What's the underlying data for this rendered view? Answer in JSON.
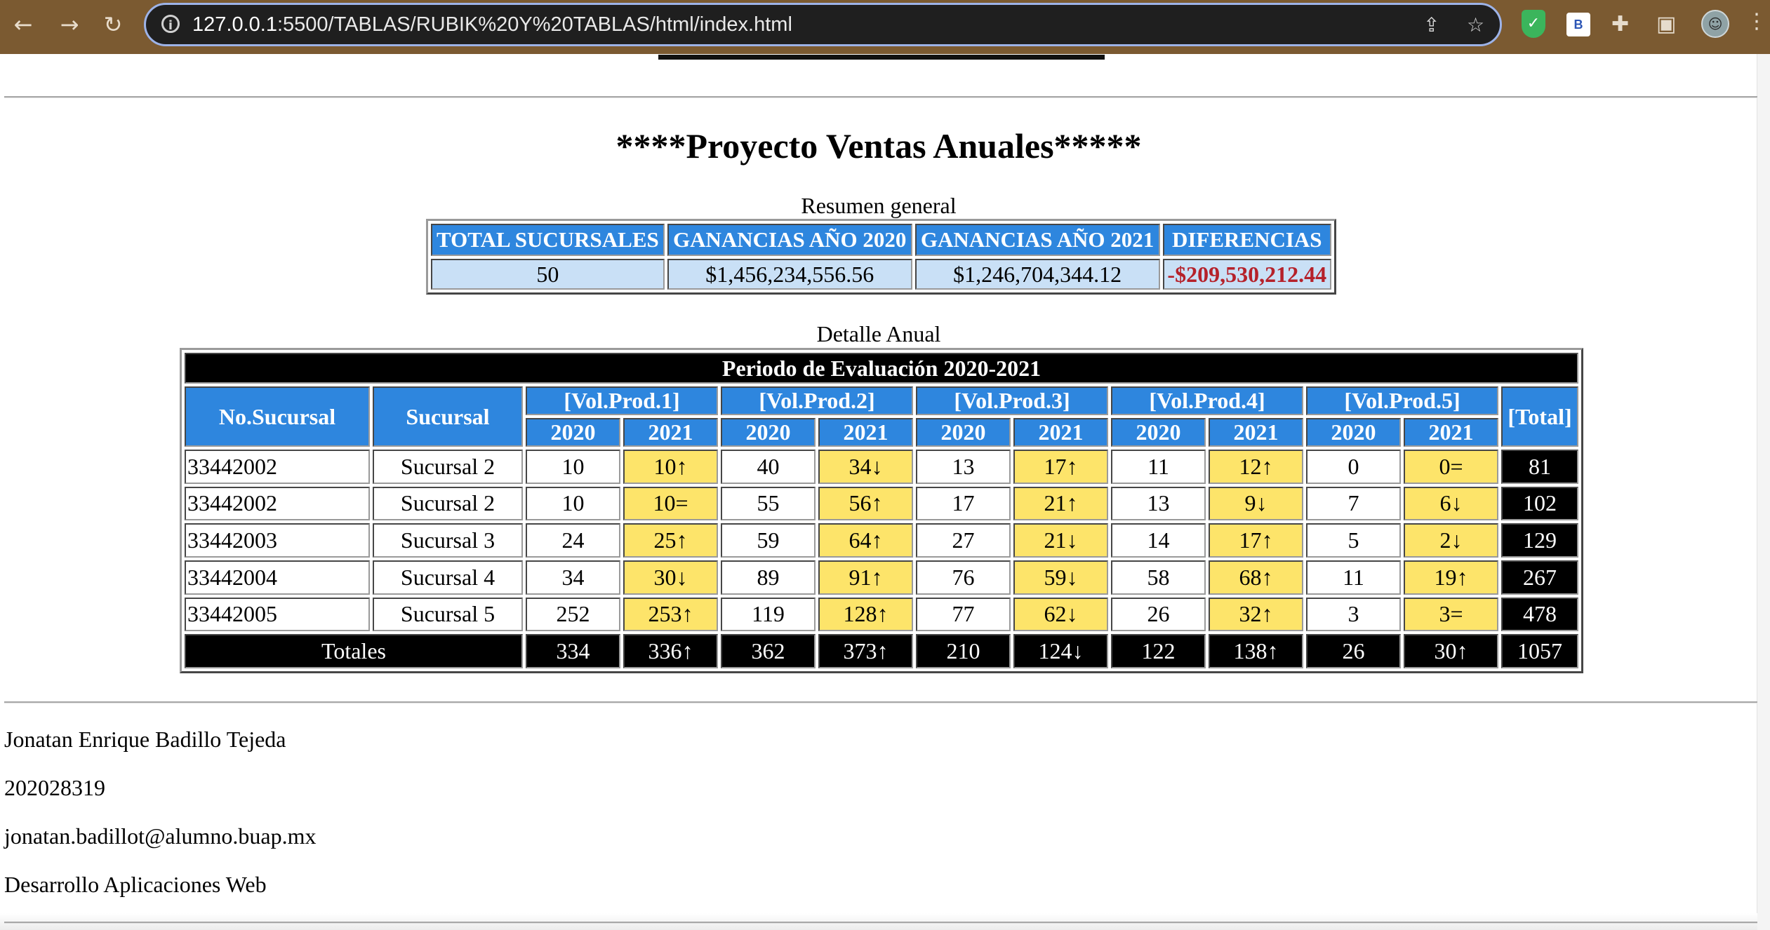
{
  "browser": {
    "url_host": "127.0.0.1",
    "url_rest": ":5500/TABLAS/RUBIK%20Y%20TABLAS/html/index.html",
    "nav_icons": [
      "back-arrow-icon",
      "forward-arrow-icon",
      "reload-icon"
    ],
    "extension_b_label": "B"
  },
  "page": {
    "title": "****Proyecto Ventas Anuales*****"
  },
  "summary": {
    "caption": "Resumen general",
    "headers": [
      "TOTAL SUCURSALES",
      "GANANCIAS AÑO 2020",
      "GANANCIAS AÑO 2021",
      "DIFERENCIAS"
    ],
    "values": [
      "50",
      "$1,456,234,556.56",
      "$1,246,704,344.12",
      "-$209,530,212.44"
    ],
    "negative_color": "#b5212a",
    "header_color": "#2e86de",
    "cell_color": "#c9e0f6"
  },
  "detail": {
    "caption": "Detalle Anual",
    "period": "Periodo de Evaluación 2020-2021",
    "col_no": "No.Sucursal",
    "col_name": "Sucursal",
    "products": [
      "[Vol.Prod.1]",
      "[Vol.Prod.2]",
      "[Vol.Prod.3]",
      "[Vol.Prod.4]",
      "[Vol.Prod.5]"
    ],
    "col_total": "[Total]",
    "year_a": "2020",
    "year_b": "2021",
    "highlight_color": "#fde46a",
    "rows": [
      {
        "no": "33442002",
        "name": "Sucursal 2",
        "cells": [
          "10",
          "10↑",
          "40",
          "34↓",
          "13",
          "17↑",
          "11",
          "12↑",
          "0",
          "0="
        ],
        "total": "81"
      },
      {
        "no": "33442002",
        "name": "Sucursal 2",
        "cells": [
          "10",
          "10=",
          "55",
          "56↑",
          "17",
          "21↑",
          "13",
          "9↓",
          "7",
          "6↓"
        ],
        "total": "102"
      },
      {
        "no": "33442003",
        "name": "Sucursal 3",
        "cells": [
          "24",
          "25↑",
          "59",
          "64↑",
          "27",
          "21↓",
          "14",
          "17↑",
          "5",
          "2↓"
        ],
        "total": "129"
      },
      {
        "no": "33442004",
        "name": "Sucursal 4",
        "cells": [
          "34",
          "30↓",
          "89",
          "91↑",
          "76",
          "59↓",
          "58",
          "68↑",
          "11",
          "19↑"
        ],
        "total": "267"
      },
      {
        "no": "33442005",
        "name": "Sucursal 5",
        "cells": [
          "252",
          "253↑",
          "119",
          "128↑",
          "77",
          "62↓",
          "26",
          "32↑",
          "3",
          "3="
        ],
        "total": "478"
      }
    ],
    "totals": {
      "label": "Totales",
      "cells": [
        "334",
        "336↑",
        "362",
        "373↑",
        "210",
        "124↓",
        "122",
        "138↑",
        "26",
        "30↑"
      ],
      "total": "1057"
    }
  },
  "footer": {
    "name": "Jonatan Enrique Badillo Tejeda",
    "id": "202028319",
    "email": "jonatan.badillot@alumno.buap.mx",
    "course": "Desarrollo Aplicaciones Web"
  }
}
